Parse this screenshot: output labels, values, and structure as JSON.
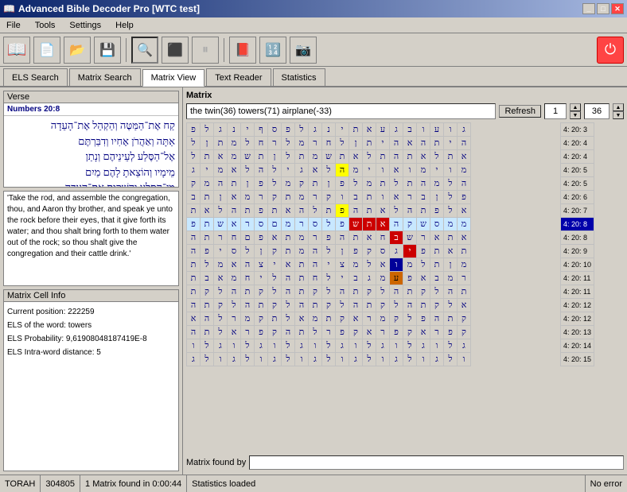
{
  "titlebar": {
    "title": "Advanced Bible Decoder Pro [WTC test]",
    "icon": "📖",
    "btns": [
      "_",
      "□",
      "✕"
    ]
  },
  "menubar": {
    "items": [
      "File",
      "Tools",
      "Settings",
      "Help"
    ]
  },
  "toolbar": {
    "buttons": [
      {
        "name": "open-bible",
        "icon": "📖"
      },
      {
        "name": "new",
        "icon": "📄"
      },
      {
        "name": "open",
        "icon": "📂"
      },
      {
        "name": "save",
        "icon": "💾"
      },
      {
        "name": "search-magnify",
        "icon": "🔍"
      },
      {
        "name": "stop",
        "icon": "⬛"
      },
      {
        "name": "pause",
        "icon": "⏸"
      },
      {
        "name": "book",
        "icon": "📕"
      },
      {
        "name": "calculator",
        "icon": "🔢"
      },
      {
        "name": "camera",
        "icon": "📷"
      }
    ],
    "power_label": "⏻"
  },
  "tabs": [
    {
      "label": "ELS Search",
      "active": false
    },
    {
      "label": "Matrix Search",
      "active": false
    },
    {
      "label": "Matrix View",
      "active": true
    },
    {
      "label": "Text Reader",
      "active": false
    },
    {
      "label": "Statistics",
      "active": false
    }
  ],
  "left_panel": {
    "verse_label": "Verse",
    "verse_ref": "Numbers 20:8",
    "verse_hebrew": "קַח אֶת־הַמַּטֶּה וְהַקְהֵל אֶת־הָעֵדָה\nאַתָּה וְאַהֲרֹן אָחִיו וְדִבַּרְתֶּם\nאֶל־הַסֶּלַע לְעֵינֵיהֶם וְנָתַן\nמֵימָיו וְהוֹצֵאתָ לָהֶם מַיִם\nמִן־הַסֶּלַע וְהִשְׁקִיתָ אֶת־הָעֵדָה\nוְאֶת־בְּעִירָם:",
    "verse_english": "'Take the rod, and assemble the congregation, thou, and Aaron thy brother, and speak ye unto the rock before their eyes, that it give forth its water; and thou shalt bring forth to them water out of the rock; so thou shalt give the congregation and their cattle drink.'",
    "cell_info_label": "Matrix Cell Info",
    "cell_info_lines": [
      "Current position: 222259",
      "ELS of the word: towers",
      "ELS Probability: 9,61908048187419E-8",
      "ELS Intra-word distance:  5"
    ]
  },
  "matrix": {
    "label": "Matrix",
    "search_text": "the twin(36) towers(71) airplane(-33)",
    "refresh_label": "Refresh",
    "spin_value": "1",
    "spin_value2": "36",
    "found_by_label": "Matrix found by",
    "found_by_value": "",
    "rows": [
      {
        "row_id": 1,
        "cells": [
          "ג",
          "ו",
          "ע",
          "ו",
          "ב",
          "ג",
          "ע",
          "א",
          "ת",
          "י",
          "נ",
          "ג",
          "ל",
          "פ",
          "ס",
          "ף",
          "י",
          "נ",
          "ג",
          "ל",
          "פ"
        ],
        "ref": "4: 20: 3"
      },
      {
        "row_id": 2,
        "cells": [
          "ה",
          "י",
          "ת",
          "ה",
          "א",
          "ה",
          "י",
          "ת",
          "ן",
          "ל",
          "ח",
          "ר",
          "מ",
          "ל",
          "ר",
          "ח",
          "ל",
          "מ",
          "ת",
          "ן",
          "ל"
        ],
        "ref": "4: 20: 4"
      },
      {
        "row_id": 3,
        "cells": [
          "א",
          "ת",
          "ל",
          "א",
          "ת",
          "ה",
          "ת",
          "ל",
          "א",
          "ת",
          "ש",
          "מ",
          "ת",
          "ל",
          "ן",
          "ת",
          "ש",
          "מ",
          "א",
          "ת",
          "ל"
        ],
        "ref": "4: 20: 4"
      },
      {
        "row_id": 4,
        "cells": [
          "מ",
          "ו",
          "י",
          "מ",
          "ו",
          "א",
          "ו",
          "י",
          "מ",
          "ה",
          "ל",
          "א",
          "ג",
          "י",
          "ל",
          "ה",
          "ל",
          "א",
          "מ",
          "י",
          "ג"
        ],
        "ref": "4: 20: 5",
        "highlight": true
      },
      {
        "row_id": 5,
        "cells": [
          "ה",
          "ל",
          "מ",
          "ה",
          "ת",
          "ל",
          "ת",
          "מ",
          "ל",
          "פ",
          "ן",
          "ת",
          "ק",
          "מ",
          "ל",
          "פ",
          "ן",
          "ת",
          "ה",
          "מ",
          "ק"
        ],
        "ref": "4: 20: 5"
      },
      {
        "row_id": 6,
        "cells": [
          "פ",
          "ל",
          "ן",
          "ב",
          "ר",
          "א",
          "ו",
          "ת",
          "ב",
          "ו",
          "ק",
          "ר",
          "מ",
          "ת",
          "ק",
          "ר",
          "מ",
          "א",
          "ן",
          "ת",
          "ב"
        ],
        "ref": "4: 20: 6"
      },
      {
        "row_id": 7,
        "cells": [
          "א",
          "ל",
          "פ",
          "ת",
          "ה",
          "ל",
          "א",
          "ת",
          "ה",
          "פ",
          "ת",
          "ל",
          "ה",
          "א",
          "ת",
          "פ",
          "ת",
          "ה",
          "ל",
          "א",
          "ת"
        ],
        "ref": "4: 20: 7"
      },
      {
        "row_id": 8,
        "cells": [
          "מ",
          "מ",
          "ס",
          "ש",
          "ק",
          "ה",
          "א",
          "ת",
          "ש",
          "פ",
          "ל",
          "ס",
          "ר",
          "מ",
          "ם",
          "ס",
          "ר",
          "א",
          "ש",
          "ת",
          "פ"
        ],
        "ref": "4: 20: 8",
        "active": true
      },
      {
        "row_id": 9,
        "cells": [
          "א",
          "ת",
          "א",
          "ר",
          "ש",
          "ב",
          "ח",
          "א",
          "ת",
          "ה",
          "פ",
          "ר",
          "מ",
          "ת",
          "א",
          "פ",
          "ם",
          "ח",
          "ר",
          "ת",
          "ה"
        ],
        "ref": "4: 20: 8"
      },
      {
        "row_id": 10,
        "cells": [
          "ת",
          "א",
          "ת",
          "פ",
          "י",
          "ג",
          "ס",
          "ק",
          "פ",
          "ן",
          "ל",
          "ה",
          "מ",
          "ת",
          "ק",
          "ן",
          "ל",
          "ס",
          "י",
          "פ",
          "ה"
        ],
        "ref": "4: 20: 9"
      },
      {
        "row_id": 11,
        "cells": [
          "מ",
          "ן",
          "ת",
          "ל",
          "מ",
          "ו",
          "א",
          "ל",
          "מ",
          "צ",
          "י",
          "ה",
          "ת",
          "א",
          "י",
          "צ",
          "ה",
          "א",
          "מ",
          "ל",
          "ת"
        ],
        "ref": "4: 20: 10"
      },
      {
        "row_id": 12,
        "cells": [
          "ר",
          "מ",
          "ב",
          "א",
          "פ",
          "ע",
          "מ",
          "ג",
          "ב",
          "י",
          "ל",
          "ח",
          "ת",
          "ה",
          "ל",
          "י",
          "ח",
          "מ",
          "א",
          "ב",
          "ת"
        ],
        "ref": "4: 20: 11"
      },
      {
        "row_id": 13,
        "cells": [
          "ת",
          "ה",
          "ל",
          "ק",
          "ת",
          "ה",
          "ל",
          "ק",
          "ת",
          "ה",
          "ל",
          "ק",
          "ת",
          "ה",
          "ל",
          "ק",
          "ת",
          "ה",
          "ל",
          "ק",
          "ת"
        ],
        "ref": "4: 20: 11"
      },
      {
        "row_id": 14,
        "cells": [
          "א",
          "ל",
          "ק",
          "ת",
          "ה",
          "ל",
          "ק",
          "ת",
          "ה",
          "ל",
          "ק",
          "ת",
          "ה",
          "ל",
          "ק",
          "ת",
          "ה",
          "ל",
          "ק",
          "ת",
          "ה"
        ],
        "ref": "4: 20: 12"
      },
      {
        "row_id": 15,
        "cells": [
          "ק",
          "ת",
          "ה",
          "פ",
          "ל",
          "ק",
          "מ",
          "ר",
          "א",
          "ק",
          "ת",
          "מ",
          "א",
          "ל",
          "ת",
          "ק",
          "מ",
          "ר",
          "ל",
          "ה",
          "א"
        ],
        "ref": "4: 20: 12"
      },
      {
        "row_id": 16,
        "cells": [
          "ק",
          "פ",
          "ר",
          "א",
          "ק",
          "פ",
          "ר",
          "א",
          "ק",
          "פ",
          "ר",
          "ל",
          "ת",
          "ה",
          "ק",
          "פ",
          "ר",
          "א",
          "ל",
          "ת",
          "ה"
        ],
        "ref": "4: 20: 13"
      },
      {
        "row_id": 17,
        "cells": [
          "ג",
          "ל",
          "ו",
          "ג",
          "ל",
          "ו",
          "ג",
          "ל",
          "ו",
          "ג",
          "ל",
          "ו",
          "ג",
          "ל",
          "ו",
          "ג",
          "ל",
          "ו",
          "ג",
          "ל",
          "ו"
        ],
        "ref": "4: 20: 14"
      },
      {
        "row_id": 18,
        "cells": [
          "ו",
          "ל",
          "ג",
          "ו",
          "ל",
          "ג",
          "ו",
          "ל",
          "ג",
          "ו",
          "ל",
          "ג",
          "ו",
          "ל",
          "ג",
          "ו",
          "ל",
          "ג",
          "ו",
          "ל",
          "ג"
        ],
        "ref": "4: 20: 15"
      }
    ],
    "highlights": {
      "yellow": [
        {
          "row": 4,
          "col": 10
        },
        {
          "row": 7,
          "col": 10
        }
      ],
      "red": [
        {
          "row": 8,
          "col": 13
        },
        {
          "row": 9,
          "col": 11
        },
        {
          "row": 10,
          "col": 11
        },
        {
          "row": 11,
          "col": 11
        }
      ],
      "blue": [
        {
          "row": 11,
          "col": 9
        }
      ],
      "orange": [
        {
          "row": 12,
          "col": 10
        }
      ]
    }
  },
  "statusbar": {
    "torah": "TORAH",
    "count": "304805",
    "matrix_info": "1 Matrix found in 0:00:44",
    "stats": "Statistics loaded",
    "error": "No error"
  }
}
